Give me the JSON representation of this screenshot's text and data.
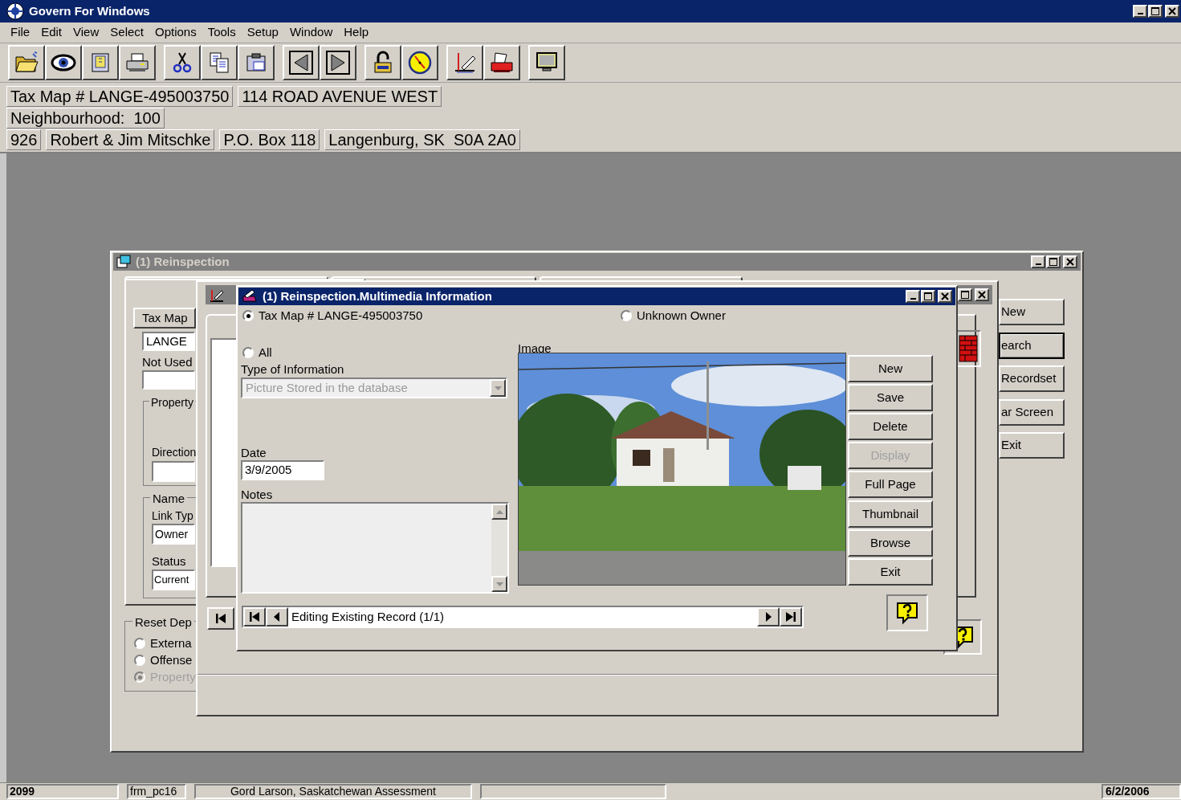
{
  "app": {
    "title": "Govern For Windows"
  },
  "menu": [
    "File",
    "Edit",
    "View",
    "Select",
    "Options",
    "Tools",
    "Setup",
    "Window",
    "Help"
  ],
  "header": {
    "tax_map": "Tax Map # LANGE-495003750",
    "address": "114 ROAD AVENUE WEST",
    "neighbourhood": "Neighbourhood:  100",
    "owner_number": "926",
    "owner_name": "Robert & Jim Mitschke",
    "mailing_address": "P.O. Box 118",
    "town": "Langenburg, SK  S0A 2A0"
  },
  "reinspection": {
    "title": "(1) Reinspection",
    "active": false,
    "tax_map_button": "Tax Map",
    "tax_map_value": "LANGE",
    "not_used_label": "Not Used",
    "property_group": "Property",
    "direction_label": "Direction",
    "name_group": "Name",
    "link_type_label": "Link Typ",
    "link_type_value": "Owner",
    "status_label": "Status",
    "status_value": "Current",
    "reset_group": "Reset Dep",
    "reset_options": [
      {
        "label": "Externa",
        "selected": false,
        "disabled": false
      },
      {
        "label": "Offense",
        "selected": false,
        "disabled": false
      },
      {
        "label": "Property",
        "selected": true,
        "disabled": true
      }
    ],
    "buttons": [
      {
        "label": "New",
        "default": false
      },
      {
        "label": "earch",
        "default": true
      },
      {
        "label": "Recordset",
        "default": false
      },
      {
        "label": "ar Screen",
        "default": false
      },
      {
        "label": "Exit",
        "default": false
      }
    ]
  },
  "multimedia": {
    "title": "(1) Reinspection.Multimedia Information",
    "active": true,
    "scope_options": [
      {
        "label": "Tax Map # LANGE-495003750",
        "selected": true
      },
      {
        "label": "Unknown Owner",
        "selected": false
      },
      {
        "label": "All",
        "selected": false
      }
    ],
    "type_label": "Type of Information",
    "type_value": "Picture Stored in the database",
    "type_disabled": true,
    "date_label": "Date",
    "date_value": "3/9/2005",
    "notes_label": "Notes",
    "image_label": "Image",
    "buttons": [
      {
        "label": "New",
        "disabled": false
      },
      {
        "label": "Save",
        "disabled": false
      },
      {
        "label": "Delete",
        "disabled": false
      },
      {
        "label": "Display",
        "disabled": true
      },
      {
        "label": "Full Page",
        "disabled": false
      },
      {
        "label": "Thumbnail",
        "disabled": false
      },
      {
        "label": "Browse",
        "disabled": false
      },
      {
        "label": "Exit",
        "disabled": false
      }
    ],
    "navigator": "Editing Existing Record (1/1)"
  },
  "status_bar": {
    "panels": [
      "2099",
      "frm_pc16",
      "Gord Larson, Saskatchewan Assessment"
    ],
    "date": "6/2/2006"
  }
}
